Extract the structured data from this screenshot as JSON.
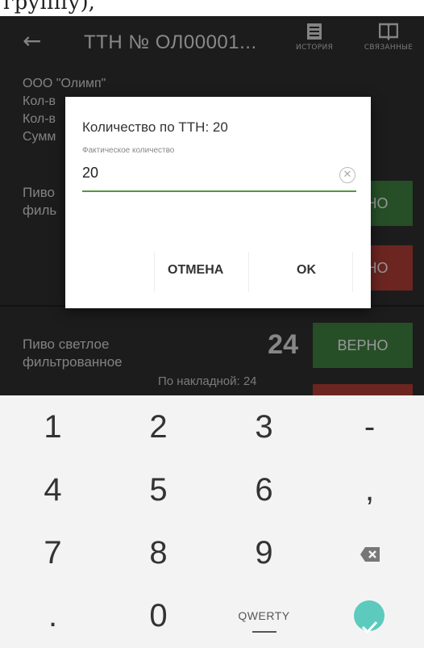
{
  "clip_text": "группу),",
  "appbar": {
    "title": "ТТН № ОЛ00001...",
    "history_label": "ИСТОРИЯ",
    "related_label": "СВЯЗАННЫЕ"
  },
  "info": {
    "org": "ООО \"Олимп\"",
    "line2": "Кол-в",
    "line3": "Кол-в",
    "line4": "Сумм"
  },
  "item1": {
    "name_line1": "Пиво",
    "name_line2": "филь",
    "btn_correct": "ВЕРНО",
    "btn_incorrect": "ВЕРНО"
  },
  "item2": {
    "name_line1": "Пиво светлое",
    "name_line2": "фильтрованное",
    "qty": "24",
    "by_invoice": "По накладной: 24",
    "btn_correct": "ВЕРНО"
  },
  "dialog": {
    "title": "Количество по ТТН: 20",
    "field_label": "Фактическое количество",
    "field_value": "20",
    "cancel": "ОТМЕНА",
    "ok": "OK"
  },
  "keyboard": {
    "row1": [
      "1",
      "2",
      "3",
      "-"
    ],
    "row2": [
      "4",
      "5",
      "6",
      ","
    ],
    "row3": [
      "7",
      "8",
      "9"
    ],
    "row4": [
      ".",
      "0",
      "QWERTY"
    ]
  },
  "colors": {
    "green": "#3b7a3c",
    "red": "#a73a33",
    "accent": "#5ccbbe",
    "input_underline": "#4e9a3f"
  }
}
